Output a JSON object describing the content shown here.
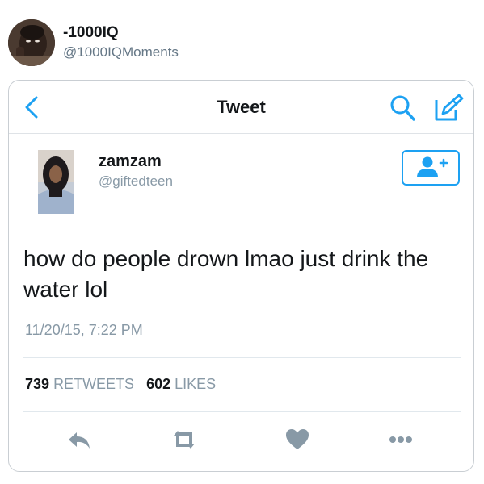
{
  "post": {
    "display_name": "-1000IQ",
    "handle": "@1000IQMoments",
    "avatar_icon": "avatar-photo"
  },
  "screenshot": {
    "navbar": {
      "title": "Tweet",
      "back_icon": "chevron-left-icon",
      "search_icon": "search-icon",
      "compose_icon": "compose-icon"
    },
    "tweet": {
      "author_name": "zamzam",
      "author_handle": "@giftedteen",
      "text": "how do people drown lmao just drink the water lol",
      "timestamp": "11/20/15, 7:22 PM",
      "retweet_count": "739",
      "retweet_label": "RETWEETS",
      "like_count": "602",
      "like_label": "LIKES"
    },
    "actions": {
      "reply": "reply-icon",
      "retweet": "retweet-icon",
      "like": "heart-icon",
      "more": "more-icon"
    },
    "colors": {
      "accent": "#1da1f2",
      "icon_gray": "#8899a6"
    }
  }
}
